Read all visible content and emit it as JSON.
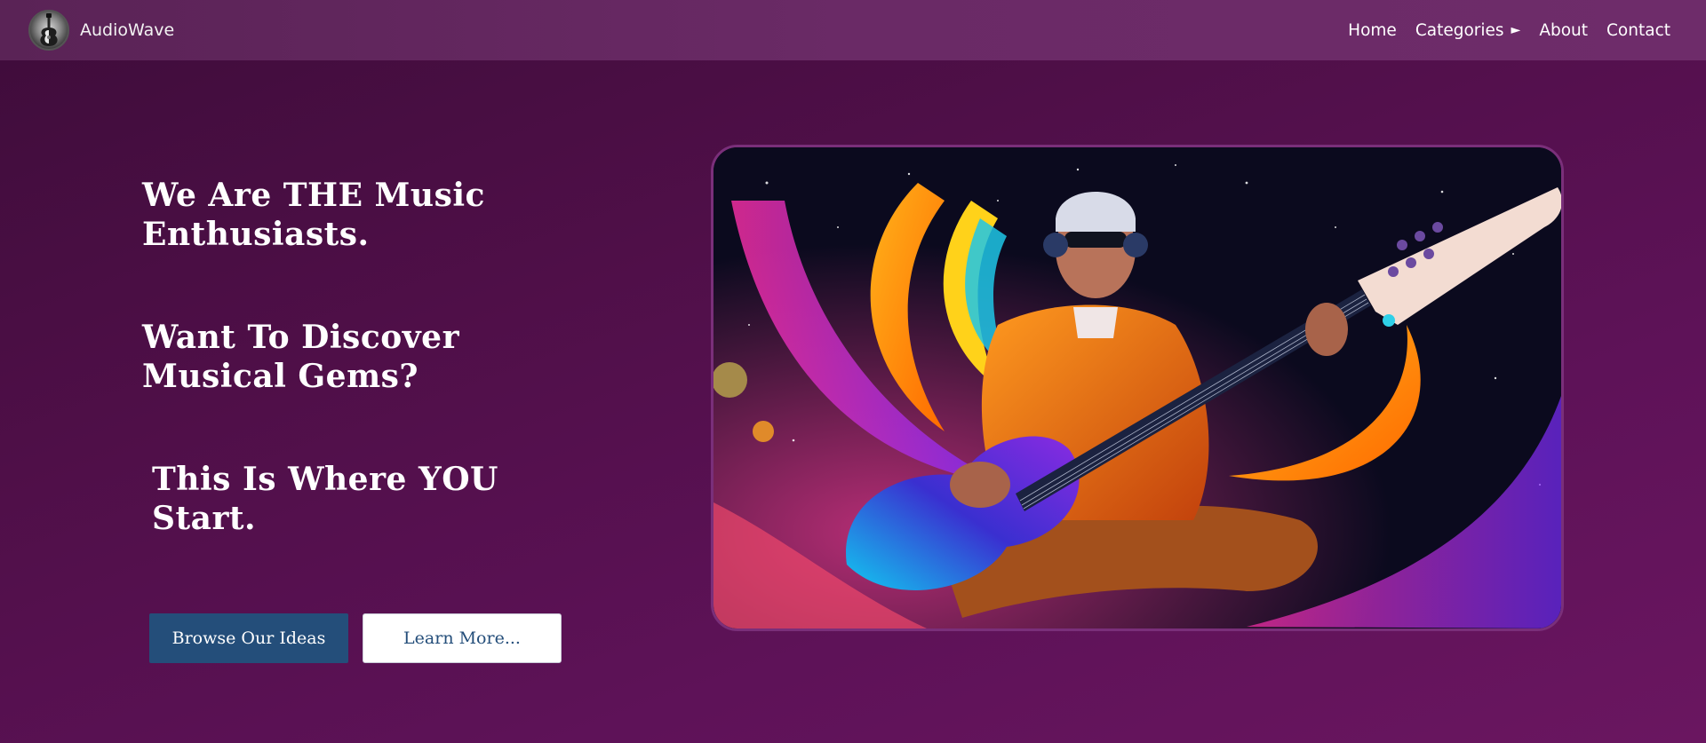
{
  "brand": {
    "name": "AudioWave",
    "logo_icon": "guitar-logo-icon"
  },
  "nav": {
    "items": [
      {
        "label": "Home"
      },
      {
        "label": "Categories",
        "icon": "triangle-right-icon",
        "icon_glyph": "►"
      },
      {
        "label": "About"
      },
      {
        "label": "Contact"
      }
    ]
  },
  "hero": {
    "heading_1": "We Are THE Music Enthusiasts.",
    "heading_2": "Want To Discover Musical Gems?",
    "heading_3": "This Is Where YOU Start.",
    "primary_button": "Browse Our Ideas",
    "secondary_button": "Learn More...",
    "image_subject": "guitarist-in-space-illustration"
  },
  "colors": {
    "background": "#4f0f48",
    "navbar": "#6a2a66",
    "primary_button": "#244e7a",
    "secondary_button_text": "#244e7a",
    "image_border": "#7a2f7a"
  }
}
